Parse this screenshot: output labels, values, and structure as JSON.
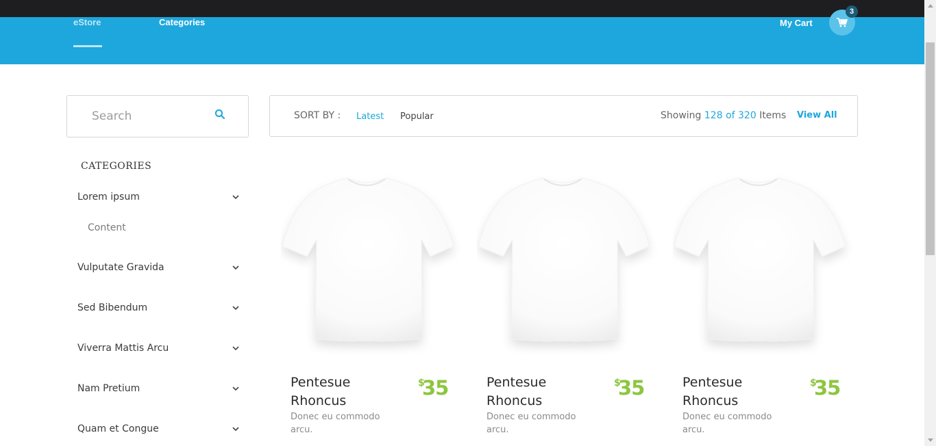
{
  "nav": {
    "brand": "eStore",
    "categories": "Categories",
    "cart_label": "My Cart",
    "cart_count": "3"
  },
  "search": {
    "placeholder": "Search"
  },
  "sidebar": {
    "title": "CATEGORIES",
    "items": [
      {
        "label": "Lorem ipsum",
        "expanded": true,
        "sub": "Content"
      },
      {
        "label": "Vulputate Gravida"
      },
      {
        "label": "Sed Bibendum"
      },
      {
        "label": "Viverra Mattis Arcu"
      },
      {
        "label": "Nam Pretium"
      },
      {
        "label": "Quam et Congue"
      }
    ]
  },
  "sort": {
    "label": "SORT BY :",
    "latest": "Latest",
    "popular": "Popular",
    "showing_prefix": "Showing",
    "showing_range": "128 of 320",
    "showing_suffix": "Items",
    "view_all": "View All"
  },
  "products": [
    {
      "name": "Pentesue Rhoncus",
      "desc": "Donec eu commodo arcu.",
      "currency": "$",
      "price": "35"
    },
    {
      "name": "Pentesue Rhoncus",
      "desc": "Donec eu commodo arcu.",
      "currency": "$",
      "price": "35"
    },
    {
      "name": "Pentesue Rhoncus",
      "desc": "Donec eu commodo arcu.",
      "currency": "$",
      "price": "35"
    }
  ],
  "colors": {
    "accent": "#1ea7dc",
    "price": "#8dc63f",
    "topbar": "#1e1e20"
  },
  "icons": {
    "cart": "shopping-cart-icon",
    "search": "search-icon",
    "chevron": "chevron-down-icon"
  }
}
